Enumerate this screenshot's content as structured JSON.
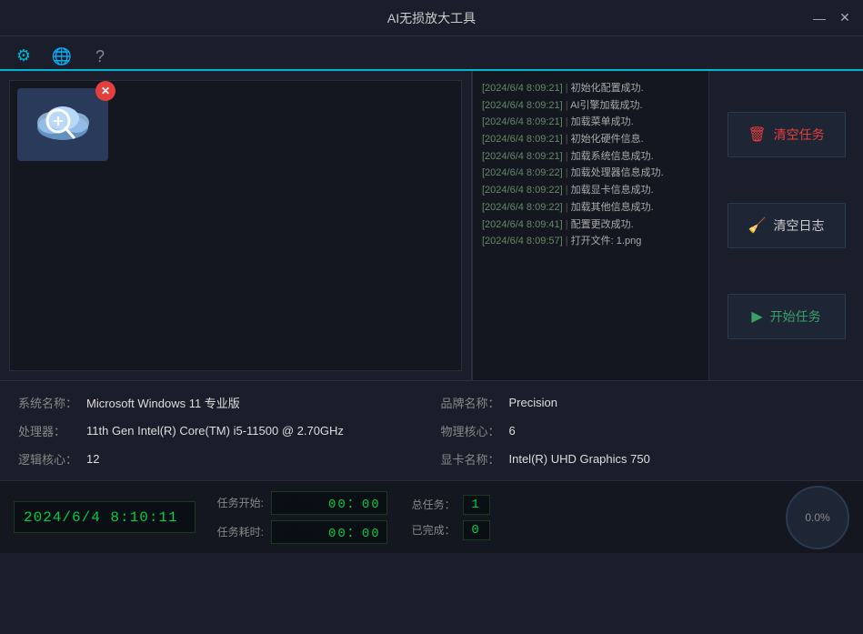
{
  "window": {
    "title": "AI无损放大工具",
    "minimize_label": "—",
    "close_label": "✕"
  },
  "navbar": {
    "icons": [
      {
        "name": "settings",
        "symbol": "⚙",
        "active": true
      },
      {
        "name": "globe",
        "symbol": "🌐",
        "active": false
      },
      {
        "name": "help",
        "symbol": "?",
        "active": false
      }
    ]
  },
  "buttons": {
    "clear_tasks": "清空任务",
    "clear_log": "清空日志",
    "start_tasks": "开始任务"
  },
  "system_info": [
    {
      "label": "系统名称：",
      "value": "Microsoft  Windows  11  专业版"
    },
    {
      "label": "品牌名称：",
      "value": "Precision"
    },
    {
      "label": "处理器：",
      "value": "11th Gen Intel(R) Core(TM) i5-11500 @ 2.70GHz"
    },
    {
      "label": "物理核心：",
      "value": "6"
    },
    {
      "label": "逻辑核心：",
      "value": "12"
    },
    {
      "label": "显卡名称：",
      "value": "Intel(R) UHD Graphics 750"
    }
  ],
  "log_entries": [
    {
      "time": "[2024/6/4 8:09:21]",
      "msg": "初始化配置成功."
    },
    {
      "time": "[2024/6/4 8:09:21]",
      "msg": "AI引擎加载成功."
    },
    {
      "time": "[2024/6/4 8:09:21]",
      "msg": "加载菜单成功."
    },
    {
      "time": "[2024/6/4 8:09:21]",
      "msg": "初始化硬件信息."
    },
    {
      "time": "[2024/6/4 8:09:21]",
      "msg": "加载系统信息成功."
    },
    {
      "time": "[2024/6/4 8:09:22]",
      "msg": "加载处理器信息成功."
    },
    {
      "time": "[2024/6/4 8:09:22]",
      "msg": "加载显卡信息成功."
    },
    {
      "time": "[2024/6/4 8:09:22]",
      "msg": "加载其他信息成功."
    },
    {
      "time": "[2024/6/4 8:09:41]",
      "msg": "配置更改成功."
    },
    {
      "time": "[2024/6/4 8:09:57]",
      "msg": "打开文件: 1.png"
    }
  ],
  "status": {
    "clock": "2024/6/4  8:10:11",
    "clock_display": "2024/6/4 8:10:11",
    "task_start_label": "任务开始:",
    "task_start_value": "00：00",
    "task_elapsed_label": "任务耗时:",
    "task_elapsed_value": "00：00",
    "total_label": "总任务：",
    "total_value": "1",
    "completed_label": "已完成：",
    "completed_value": "0",
    "progress": "0.0%"
  }
}
